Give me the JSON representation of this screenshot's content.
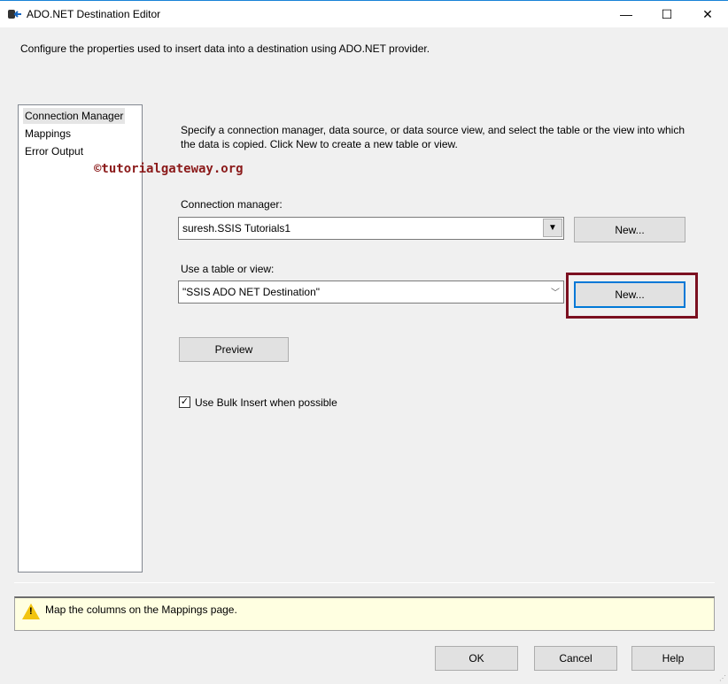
{
  "window": {
    "title": "ADO.NET Destination Editor",
    "minimize": "—",
    "maximize": "☐",
    "close": "✕"
  },
  "description": "Configure the properties used to insert data into a destination using ADO.NET provider.",
  "nav": {
    "items": [
      {
        "label": "Connection Manager",
        "selected": true
      },
      {
        "label": "Mappings"
      },
      {
        "label": "Error Output"
      }
    ]
  },
  "watermark": "©tutorialgateway.org",
  "main": {
    "instructions_line1": "Specify a connection manager, data source, or data source view, and select the table or the view into which",
    "instructions_line2": "the data is copied. Click New to create a new table or view.",
    "connection_label": "Connection manager:",
    "connection_value": "suresh.SSIS Tutorials1",
    "new_connection": "New...",
    "table_label": "Use a table or view:",
    "table_value": "\"SSIS ADO NET Destination\"",
    "new_table": "New...",
    "preview": "Preview",
    "bulk_insert_label": "Use Bulk Insert when possible",
    "bulk_insert_checked": true
  },
  "message": "Map the columns on the Mappings page.",
  "footer": {
    "ok": "OK",
    "cancel": "Cancel",
    "help": "Help"
  },
  "colors": {
    "highlight": "#7b1020",
    "focus": "#0078d7",
    "message_bg": "#ffffe1"
  }
}
